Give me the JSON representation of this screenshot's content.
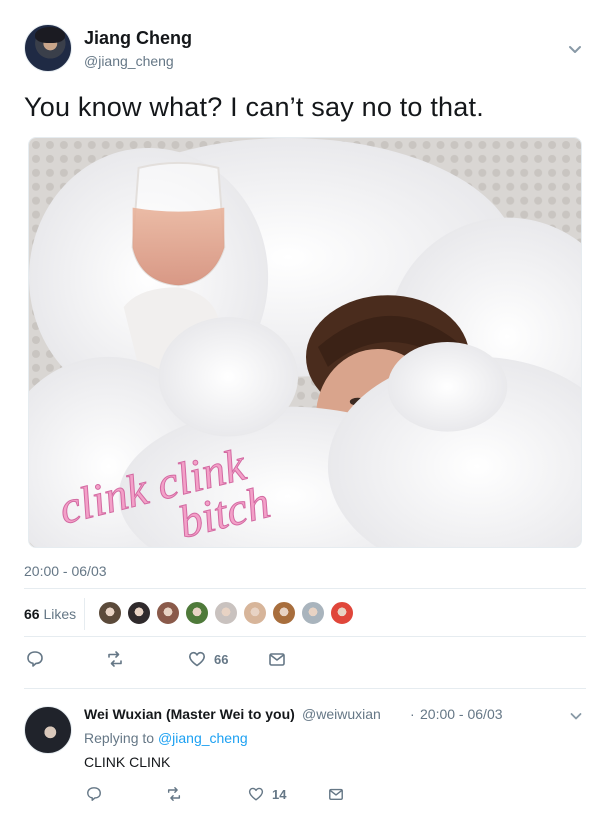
{
  "tweet": {
    "author_name": "Jiang Cheng",
    "author_handle": "@jiang_cheng",
    "text": "You know what? I can’t say no to that.",
    "media_caption_line1": "clink clink",
    "media_caption_line2": "bitch",
    "timestamp": "20:00 - 06/03",
    "likes_count": "66",
    "likes_label": "Likes",
    "actions": {
      "reply_count": "",
      "retweet_count": "",
      "like_count": "66"
    }
  },
  "likers": [
    {
      "color": "#5b4a3a"
    },
    {
      "color": "#2f2a2c"
    },
    {
      "color": "#8a5a4a"
    },
    {
      "color": "#4f7a3a"
    },
    {
      "color": "#c9c2bf"
    },
    {
      "color": "#d7b59a"
    },
    {
      "color": "#a86e3d"
    },
    {
      "color": "#a9b4bd"
    },
    {
      "color": "#e0463a"
    }
  ],
  "reply": {
    "author_name": "Wei Wuxian (Master Wei to you)",
    "author_handle": "@weiwuxian",
    "separator": "·",
    "timestamp": "20:00 - 06/03",
    "replying_prefix": "Replying to",
    "replying_to": "@jiang_cheng",
    "text": "CLINK CLINK",
    "actions": {
      "like_count": "14"
    }
  },
  "icons": {
    "caret": "chevron-down-icon",
    "reply": "reply-icon",
    "retweet": "retweet-icon",
    "like": "heart-icon",
    "dm": "envelope-icon"
  },
  "colors": {
    "link": "#1da1f2",
    "muted": "#657786",
    "divider": "#e6ecf0",
    "caption": "#e57ab0"
  }
}
